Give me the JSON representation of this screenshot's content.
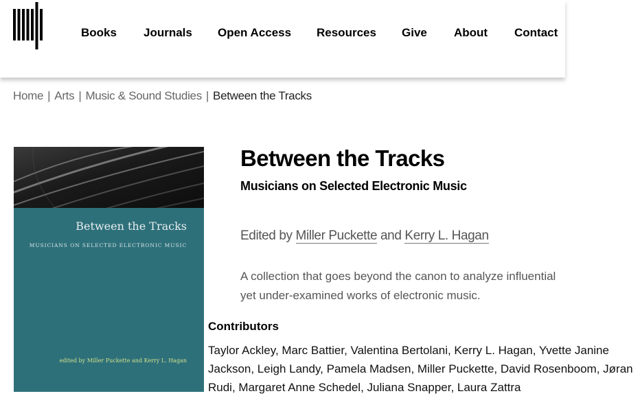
{
  "nav": {
    "items": [
      "Books",
      "Journals",
      "Open Access",
      "Resources",
      "Give",
      "About",
      "Contact"
    ]
  },
  "breadcrumb": {
    "items": [
      "Home",
      "Arts",
      "Music & Sound Studies"
    ],
    "current": "Between the Tracks",
    "separator": "|"
  },
  "cover": {
    "title": "Between the Tracks",
    "subtitle": "MUSICIANS ON SELECTED ELECTRONIC MUSIC",
    "editors": "edited by Miller Puckette and Kerry L. Hagan",
    "color": "#2e707a"
  },
  "book": {
    "title": "Between the Tracks",
    "subtitle": "Musicians on Selected Electronic Music",
    "edited_by": "Edited by",
    "editor1": "Miller Puckette",
    "and": "and",
    "editor2": "Kerry L. Hagan",
    "description": "A collection that goes beyond the canon to analyze influential yet under-examined works of electronic music."
  },
  "contributors": {
    "heading": "Contributors",
    "list": "Taylor Ackley, Marc Battier, Valentina Bertolani, Kerry L. Hagan, Yvette Janine Jackson, Leigh Landy, Pamela Madsen, Miller Puckette, David Rosenboom, Jøran Rudi, Margaret Anne Schedel, Juliana Snapper, Laura Zattra"
  }
}
